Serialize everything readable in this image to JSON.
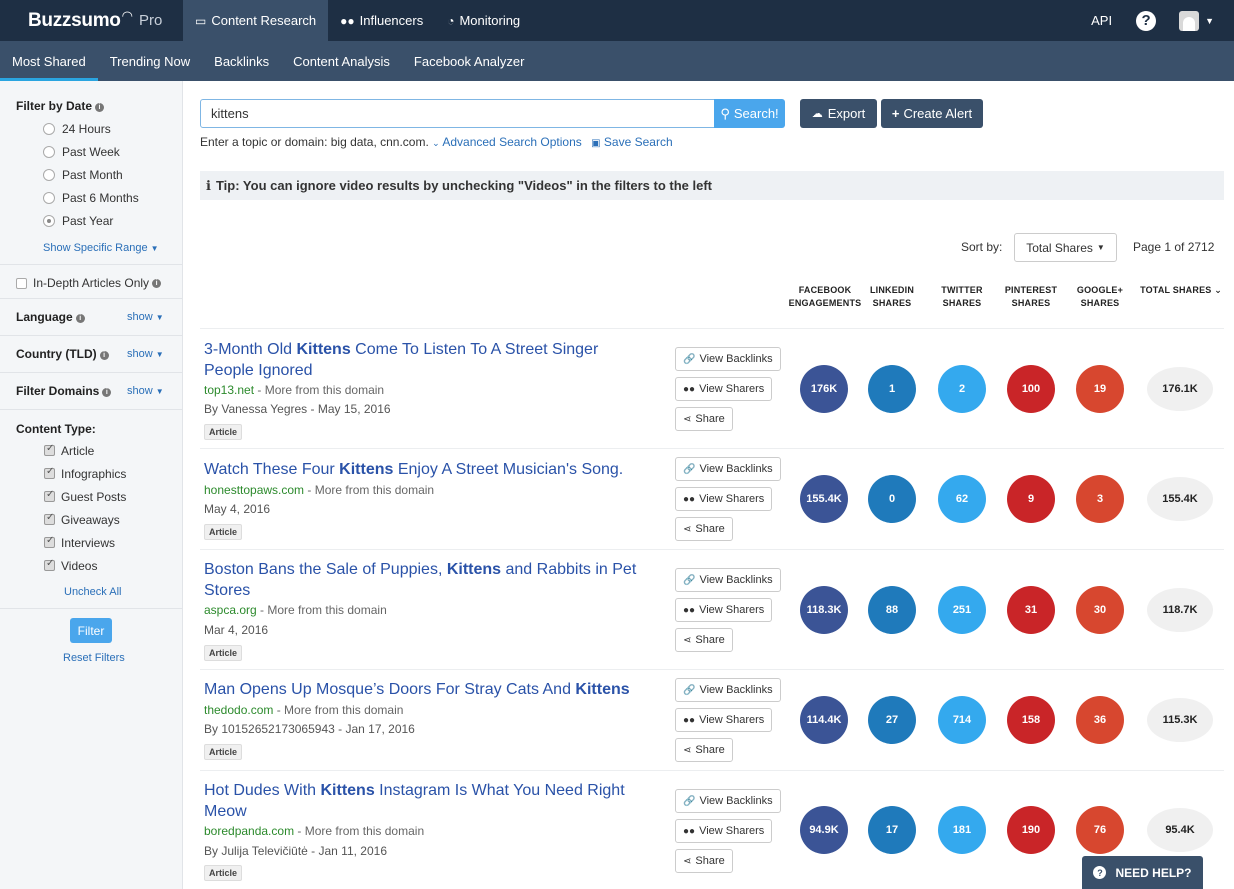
{
  "brand": {
    "name": "Buzzsumo",
    "tier": "Pro"
  },
  "topnav": {
    "items": [
      {
        "label": "Content Research",
        "icon": "laptop-icon"
      },
      {
        "label": "Influencers",
        "icon": "users-icon"
      },
      {
        "label": "Monitoring",
        "icon": "dashboard-icon"
      }
    ],
    "api": "API"
  },
  "subnav": [
    "Most Shared",
    "Trending Now",
    "Backlinks",
    "Content Analysis",
    "Facebook Analyzer"
  ],
  "sidebar": {
    "filter_date_title": "Filter by Date",
    "date_options": [
      "24 Hours",
      "Past Week",
      "Past Month",
      "Past 6 Months",
      "Past Year"
    ],
    "selected_date": "Past Year",
    "show_range": "Show Specific Range",
    "in_depth": "In-Depth Articles Only",
    "language": "Language",
    "country": "Country (TLD)",
    "domains": "Filter Domains",
    "show": "show",
    "content_type_title": "Content Type:",
    "content_types": [
      "Article",
      "Infographics",
      "Guest Posts",
      "Giveaways",
      "Interviews",
      "Videos"
    ],
    "uncheck_all": "Uncheck All",
    "filter_btn": "Filter",
    "reset": "Reset Filters"
  },
  "search": {
    "value": "kittens",
    "button": "Search!",
    "export": "Export",
    "create_alert": "Create Alert",
    "hint": "Enter a topic or domain: big data, cnn.com.",
    "advanced": "Advanced Search Options",
    "save": "Save Search"
  },
  "tip": "Tip: You can ignore video results by unchecking \"Videos\" in the filters to the left",
  "sort": {
    "label": "Sort by:",
    "value": "Total Shares",
    "page": "Page 1 of 2712"
  },
  "columns": [
    [
      "FACEBOOK",
      "ENGAGEMENTS"
    ],
    [
      "LINKEDIN",
      "SHARES"
    ],
    [
      "TWITTER",
      "SHARES"
    ],
    [
      "PINTEREST",
      "SHARES"
    ],
    [
      "GOOGLE+",
      "SHARES"
    ],
    [
      "TOTAL SHARES",
      ""
    ]
  ],
  "actions": {
    "backlinks": "View Backlinks",
    "sharers": "View Sharers",
    "share": "Share"
  },
  "more_from": " - More from this domain",
  "results": [
    {
      "pre": "3-Month Old ",
      "kw": "Kittens",
      "post": " Come To Listen To A Street Singer People Ignored",
      "domain": "top13.net",
      "by": "By Vanessa Yegres - May 15, 2016",
      "type": "Article",
      "fb": "176K",
      "li": "1",
      "tw": "2",
      "pi": "100",
      "gp": "19",
      "total": "176.1K"
    },
    {
      "pre": "Watch These Four ",
      "kw": "Kittens",
      "post": " Enjoy A Street Musician's Song.",
      "domain": "honesttopaws.com",
      "by": "May 4, 2016",
      "type": "Article",
      "fb": "155.4K",
      "li": "0",
      "tw": "62",
      "pi": "9",
      "gp": "3",
      "total": "155.4K"
    },
    {
      "pre": "Boston Bans the Sale of Puppies, ",
      "kw": "Kittens",
      "post": " and Rabbits in Pet Stores",
      "domain": "aspca.org",
      "by": "Mar 4, 2016",
      "type": "Article",
      "fb": "118.3K",
      "li": "88",
      "tw": "251",
      "pi": "31",
      "gp": "30",
      "total": "118.7K"
    },
    {
      "pre": "Man Opens Up Mosque’s Doors For Stray Cats And ",
      "kw": "Kittens",
      "post": "",
      "domain": "thedodo.com",
      "by": "By 10152652173065943 - Jan 17, 2016",
      "type": "Article",
      "fb": "114.4K",
      "li": "27",
      "tw": "714",
      "pi": "158",
      "gp": "36",
      "total": "115.3K"
    },
    {
      "pre": "Hot Dudes With ",
      "kw": "Kittens",
      "post": " Instagram Is What You Need Right Meow",
      "domain": "boredpanda.com",
      "by": "By Julija Televičiūtė - Jan 11, 2016",
      "type": "Article",
      "fb": "94.9K",
      "li": "17",
      "tw": "181",
      "pi": "190",
      "gp": "76",
      "total": "95.4K"
    }
  ],
  "need_help": "NEED HELP?"
}
